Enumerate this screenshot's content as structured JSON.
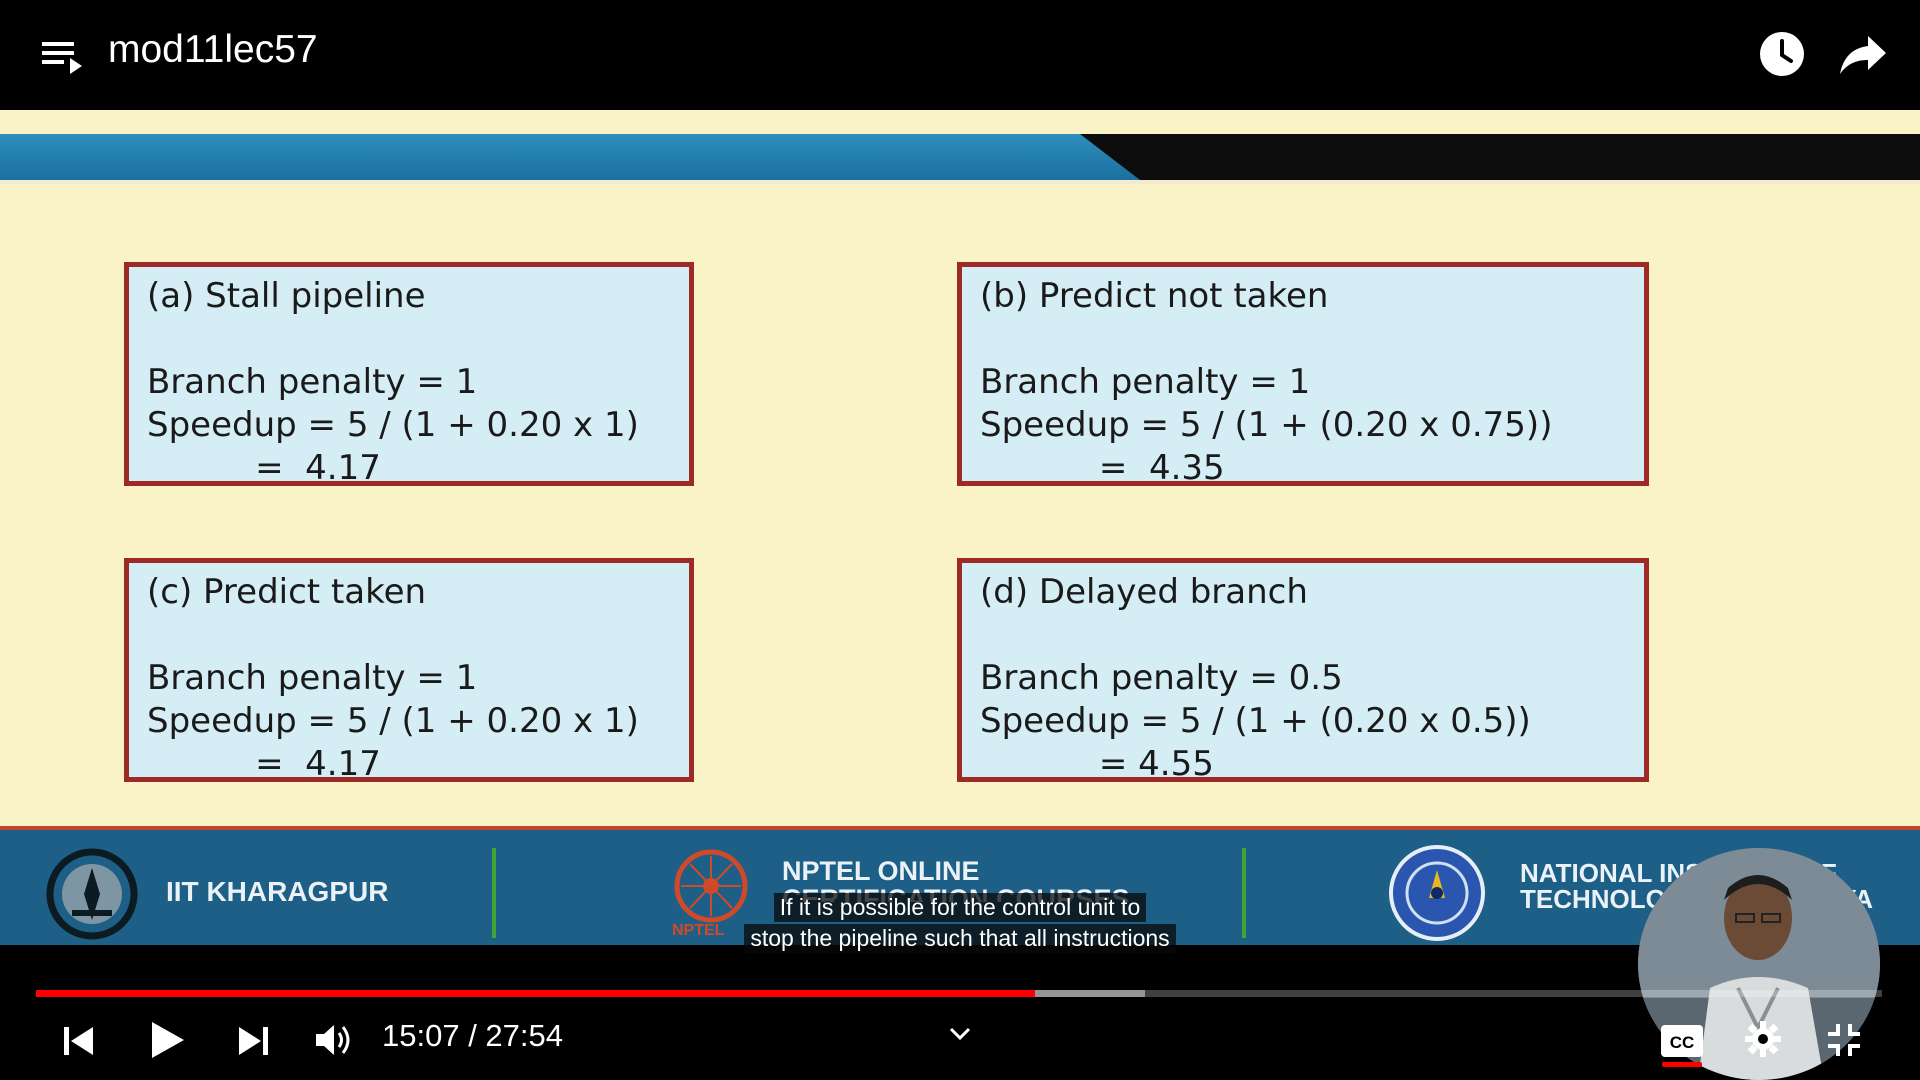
{
  "header": {
    "title": "mod11lec57"
  },
  "slide": {
    "cards": [
      {
        "heading": "(a)  Stall pipeline",
        "penalty": "Branch penalty = 1",
        "speedup": "Speedup = 5 / (1 + 0.20 x 1)",
        "result": "          =  4.17"
      },
      {
        "heading": "(b)  Predict not taken",
        "penalty": "Branch penalty = 1",
        "speedup": "Speedup = 5 / (1 + (0.20 x 0.75))",
        "result": "           =  4.35"
      },
      {
        "heading": "(c)  Predict taken",
        "penalty": "Branch penalty = 1",
        "speedup": "Speedup = 5 / (1 + 0.20 x 1)",
        "result": "          =  4.17"
      },
      {
        "heading": "(d)  Delayed branch",
        "penalty": "Branch penalty = 0.5",
        "speedup": "Speedup = 5 / (1 + (0.20 x 0.5))",
        "result": "           = 4.55"
      }
    ],
    "footer": {
      "left_text": "IIT KHARAGPUR",
      "mid_text_1": "NPTEL ONLINE",
      "mid_text_2": "CERTIFICATION COURSES",
      "mid_small": "NPTEL",
      "right_text_1": "NATIONAL INSTITUTE OF",
      "right_text_2": "TECHNOLOGY MEGHALAYA"
    }
  },
  "captions": {
    "line1": "If it is possible for the control unit to",
    "line2": "stop the pipeline such that all instructions"
  },
  "player": {
    "time": "15:07 / 27:54",
    "progress_played_fraction": 0.541,
    "progress_buffered_fraction": 0.601,
    "colors": {
      "accent": "#ff0000"
    }
  }
}
